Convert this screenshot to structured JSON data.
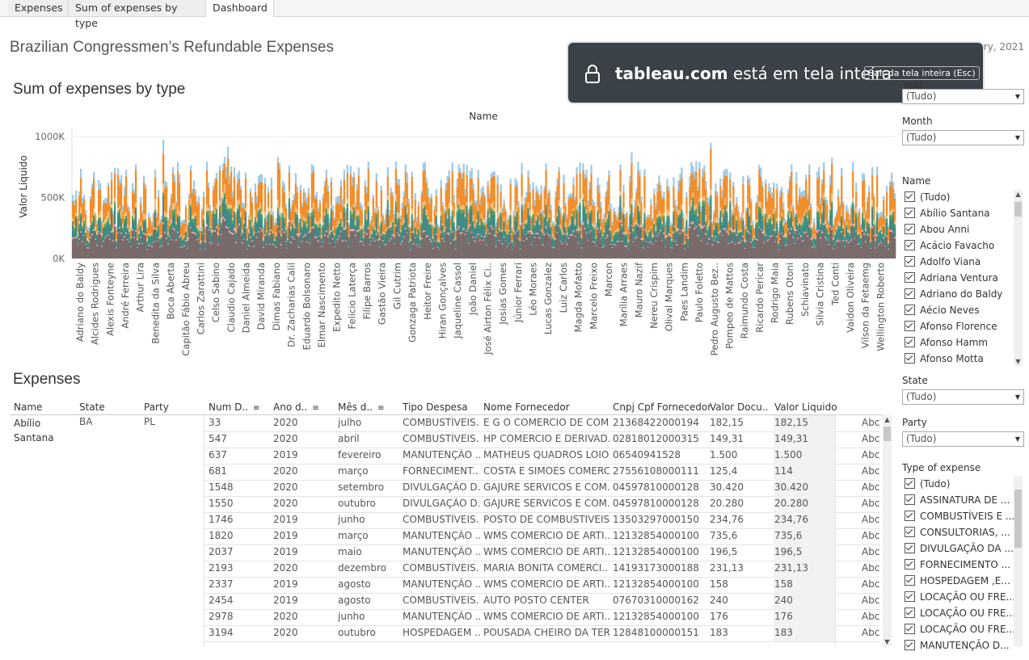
{
  "tabs": [
    "Expenses",
    "Sum of expenses by type",
    "Dashboard"
  ],
  "dashboard_title": "Brazilian Congressmen’s Refundable Expenses",
  "last_updated": "Last updated: January, 2021",
  "toast": {
    "site": "tableau.com",
    "text": " está em tela inteira",
    "button": "Sair da tela inteira (Esc)"
  },
  "chart_title": "Sum of expenses by type",
  "expenses_title": "Expenses",
  "chart_data": {
    "type": "bar",
    "title": "Name",
    "ylabel": "Valor Liquido",
    "ylim": [
      0,
      1000000
    ],
    "yticks": [
      "1000K",
      "500K",
      "0K"
    ],
    "stacked": true,
    "series_colors": [
      "#7a6b6b",
      "#f28e2b",
      "#3d8c86",
      "#a0cbe8",
      "#ffbe7d",
      "#59a14f",
      "#ff9da7",
      "#86bcb6"
    ],
    "categories": [
      "Adriano do Baldy",
      "Alcides Rodrigues",
      "Alexis Fonteyne",
      "André Ferreira",
      "Arthur Lira",
      "Benedita da Silva",
      "Boca Aberta",
      "Capitão Fábio Abreu",
      "Carlos Zarattini",
      "Celso Sabino",
      "Claudio Cajado",
      "Daniel Almeida",
      "David Miranda",
      "Dimas Fabiano",
      "Dr. Zacharias Calil",
      "Eduardo Bolsonaro",
      "Elmar Nascimento",
      "Expedito Netto",
      "Felício Laterça",
      "Filipe Barros",
      "Gastão Vieira",
      "Gil Cutrim",
      "Gonzaga Patriota",
      "Heitor Freire",
      "Hiran Gonçalves",
      "Jaqueline Cassol",
      "João Daniel",
      "José Airton Félix Ci..",
      "Josias Gomes",
      "Júnior Ferrari",
      "Léo Moraes",
      "Lucas Gonzalez",
      "Luiz Carlos",
      "Magda Mofatto",
      "Marcelo Freixo",
      "Marcon",
      "Marília Arraes",
      "Mauro Nazif",
      "Nereu Crispim",
      "Olival Marques",
      "Paes Landim",
      "Paulo Foletto",
      "Pedro Augusto Bez..",
      "Pompeo de Mattos",
      "Raimundo Costa",
      "Ricardo Pericar",
      "Rodrigo Maia",
      "Rubens Otoni",
      "Schiavinato",
      "Silvia Cristina",
      "Ted Conti",
      "Vaidon Oliveira",
      "Vilson da Fetaemg",
      "Wellington Roberto"
    ]
  },
  "filters": {
    "year_label": "Year",
    "year_value": "(Tudo)",
    "month_label": "Month",
    "month_value": "(Tudo)",
    "name_label": "Name",
    "names": [
      "(Tudo)",
      "Abílio Santana",
      "Abou Anni",
      "Acácio Favacho",
      "Adolfo Viana",
      "Adriana Ventura",
      "Adriano do Baldy",
      "Aécio Neves",
      "Afonso Florence",
      "Afonso Hamm",
      "Afonso Motta"
    ],
    "state_label": "State",
    "state_value": "(Tudo)",
    "party_label": "Party",
    "party_value": "(Tudo)",
    "type_label": "Type of expense",
    "types": [
      "(Tudo)",
      "ASSINATURA DE ...",
      "COMBUSTÍVEIS E ...",
      "CONSULTORIAS, ...",
      "DIVULGAÇÃO DA ...",
      "FORNECIMENTO ...",
      "HOSPEDAGEM ,E...",
      "LOCAÇÃO OU FRE...",
      "LOCAÇÃO OU FRE...",
      "LOCAÇÃO OU FRE...",
      "MANUTENÇÃO D..."
    ]
  },
  "table": {
    "headers": [
      "Name",
      "State",
      "Party",
      "Num D..",
      "Ano d..",
      "Mês d..",
      "Tipo Despesa",
      "Nome Fornecedor",
      "Cnpj Cpf Fornecedor",
      "Valor Docu..",
      "Valor Liquido"
    ],
    "name": "Abílio Santana",
    "state": "BA",
    "party": "PL",
    "rows": [
      [
        "33",
        "2020",
        "julho",
        "COMBUSTÍVEIS..",
        "E G O COMERCIO DE COM..",
        "21368422000194",
        "182,15",
        "182,15",
        "Abc"
      ],
      [
        "547",
        "2020",
        "abril",
        "COMBUSTÍVEIS..",
        "HP COMERCIO E DERIVAD..",
        "02818012000315",
        "149,31",
        "149,31",
        "Abc"
      ],
      [
        "637",
        "2019",
        "fevereiro",
        "MANUTENÇÃO ..",
        "MATHEUS QUADROS LOIO..",
        "06540941528",
        "1.500",
        "1.500",
        "Abc"
      ],
      [
        "681",
        "2020",
        "março",
        "FORNECIMENT..",
        "COSTA E SIMOES COMERC..",
        "27556108000111",
        "125,4",
        "114",
        "Abc"
      ],
      [
        "1548",
        "2020",
        "setembro",
        "DIVULGAÇÃO D..",
        "GAJURE SERVICOS E COM..",
        "04597810000128",
        "30.420",
        "30.420",
        "Abc"
      ],
      [
        "1550",
        "2020",
        "outubro",
        "DIVULGAÇÃO D..",
        "GAJURE SERVICOS E COM..",
        "04597810000128",
        "20.280",
        "20.280",
        "Abc"
      ],
      [
        "1746",
        "2019",
        "junho",
        "COMBUSTÍVEIS..",
        "POSTO DE COMBUSTIVEIS..",
        "13503297000150",
        "234,76",
        "234,76",
        "Abc"
      ],
      [
        "1820",
        "2019",
        "março",
        "MANUTENÇÃO ..",
        "WMS COMERCIO DE ARTI..",
        "12132854000100",
        "735,6",
        "735,6",
        "Abc"
      ],
      [
        "2037",
        "2019",
        "maio",
        "MANUTENÇÃO ..",
        "WMS COMERCIO DE ARTI..",
        "12132854000100",
        "196,5",
        "196,5",
        "Abc"
      ],
      [
        "2193",
        "2020",
        "dezembro",
        "COMBUSTÍVEIS..",
        "MARIA BONITA COMERCI..",
        "14193173000188",
        "231,13",
        "231,13",
        "Abc"
      ],
      [
        "2337",
        "2019",
        "agosto",
        "MANUTENÇÃO ..",
        "WMS COMERCIO DE ARTI..",
        "12132854000100",
        "158",
        "158",
        "Abc"
      ],
      [
        "2454",
        "2019",
        "agosto",
        "COMBUSTÍVEIS..",
        "AUTO POSTO CENTER",
        "07670310000162",
        "240",
        "240",
        "Abc"
      ],
      [
        "2978",
        "2020",
        "junho",
        "MANUTENÇÃO ..",
        "WMS COMERCIO DE ARTI..",
        "12132854000100",
        "176",
        "176",
        "Abc"
      ],
      [
        "3194",
        "2020",
        "outubro",
        "HOSPEDAGEM ..",
        "POUSADA CHEIRO DA TER..",
        "12848100000151",
        "183",
        "183",
        "Abc"
      ]
    ]
  }
}
